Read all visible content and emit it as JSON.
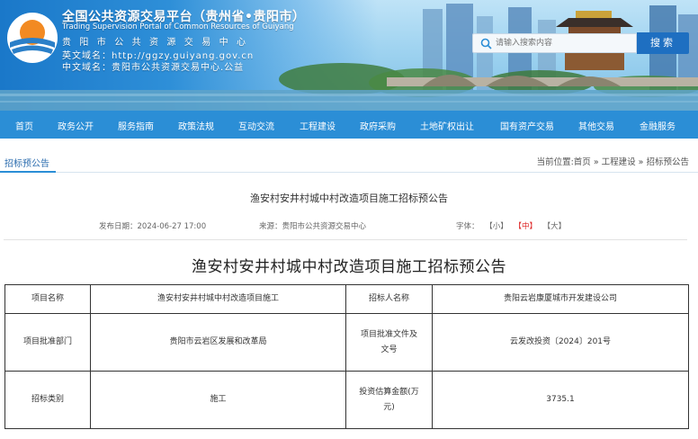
{
  "banner": {
    "title_cn": "全国公共资源交易平台（贵州省•贵阳市）",
    "title_en": "Trading Supervision Portal of Common Resources of Guiyang",
    "center_name": "贵阳市公共资源交易中心",
    "domain_en": "英文域名：http://ggzy.guiyang.gov.cn",
    "domain_cn": "中文域名：贵阳市公共资源交易中心.公益"
  },
  "search": {
    "placeholder": "请输入搜索内容",
    "button_label": "搜索"
  },
  "nav": {
    "items": [
      {
        "label": "首页"
      },
      {
        "label": "政务公开"
      },
      {
        "label": "服务指南"
      },
      {
        "label": "政策法规"
      },
      {
        "label": "互动交流"
      },
      {
        "label": "工程建设"
      },
      {
        "label": "政府采购"
      },
      {
        "label": "土地矿权出让"
      },
      {
        "label": "国有资产交易"
      },
      {
        "label": "其他交易"
      },
      {
        "label": "金融服务"
      }
    ]
  },
  "crumb": {
    "section_title": "招标预公告",
    "breadcrumb": "当前位置:首页 » 工程建设 » 招标预公告"
  },
  "article": {
    "title": "渔安村安井村城中村改造项目施工招标预公告",
    "publish_date": "发布日期：2024-06-27 17:00",
    "source": "来源：贵阳市公共资源交易中心",
    "font_label": "字体：",
    "font_small": "【小】",
    "font_medium": "【中】",
    "font_large": "【大】",
    "doc_title": "渔安村安井村城中村改造项目施工招标预公告"
  },
  "table": {
    "rows": [
      {
        "k1": "项目名称",
        "v1": "渔安村安井村城中村改造项目施工",
        "k2": "招标人名称",
        "v2": "贵阳云岩康厦城市开发建设公司"
      },
      {
        "k1": "项目批准部门",
        "v1": "贵阳市云岩区发展和改革局",
        "k2": "项目批准文件及文号",
        "v2": "云发改投资〔2024〕201号"
      },
      {
        "k1": "招标类别",
        "v1": "施工",
        "k2": "投资估算金额(万元)",
        "v2": "3735.1"
      }
    ]
  },
  "colors": {
    "nav_bg": "#2b8ed6",
    "search_button": "#1e6fc1",
    "font_active": "#dd2222"
  }
}
